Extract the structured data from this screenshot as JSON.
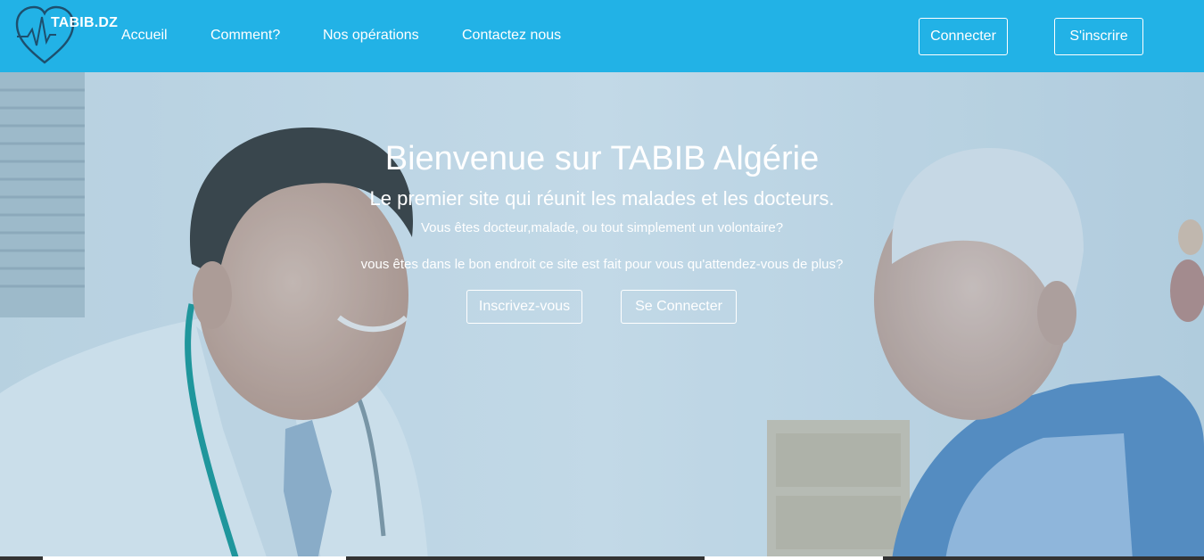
{
  "navbar": {
    "logo_text": "TABIB.DZ",
    "links": [
      {
        "label": "Accueil"
      },
      {
        "label": "Comment?"
      },
      {
        "label": "Nos opérations"
      },
      {
        "label": "Contactez nous"
      }
    ],
    "login_label": "Connecter",
    "signup_label": "S'inscrire"
  },
  "hero": {
    "title": "Bienvenue sur TABIB Algérie",
    "subtitle": "Le premier site qui réunit les malades et les docteurs.",
    "line1": "Vous êtes docteur,malade, ou tout simplement un volontaire?",
    "line2": "vous êtes dans le bon endroit ce site est fait pour vous qu'attendez-vous de plus?",
    "signup_label": "Inscrivez-vous",
    "login_label": "Se Connecter"
  },
  "colors": {
    "navbar_bg": "#22b2e6",
    "text": "#ffffff"
  },
  "icons": {
    "logo": "heart-pulse-icon"
  }
}
